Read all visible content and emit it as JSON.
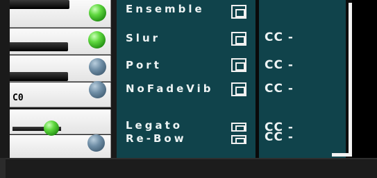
{
  "keyboard": {
    "octave_label": "C0"
  },
  "articulations": [
    {
      "label": "Ensemble",
      "cc": ""
    },
    {
      "label": "Slur",
      "cc": "CC -"
    },
    {
      "label": "Port",
      "cc": "CC -"
    },
    {
      "label": "NoFadeVib",
      "cc": "CC -"
    },
    {
      "label": "Legato",
      "cc": "CC -"
    },
    {
      "label": "Re-Bow",
      "cc": "CC -"
    }
  ],
  "colors": {
    "panel": "#10434b",
    "led_active": "#5fd83f",
    "led_inactive": "#6f8ea6",
    "text": "#eef4f4"
  }
}
